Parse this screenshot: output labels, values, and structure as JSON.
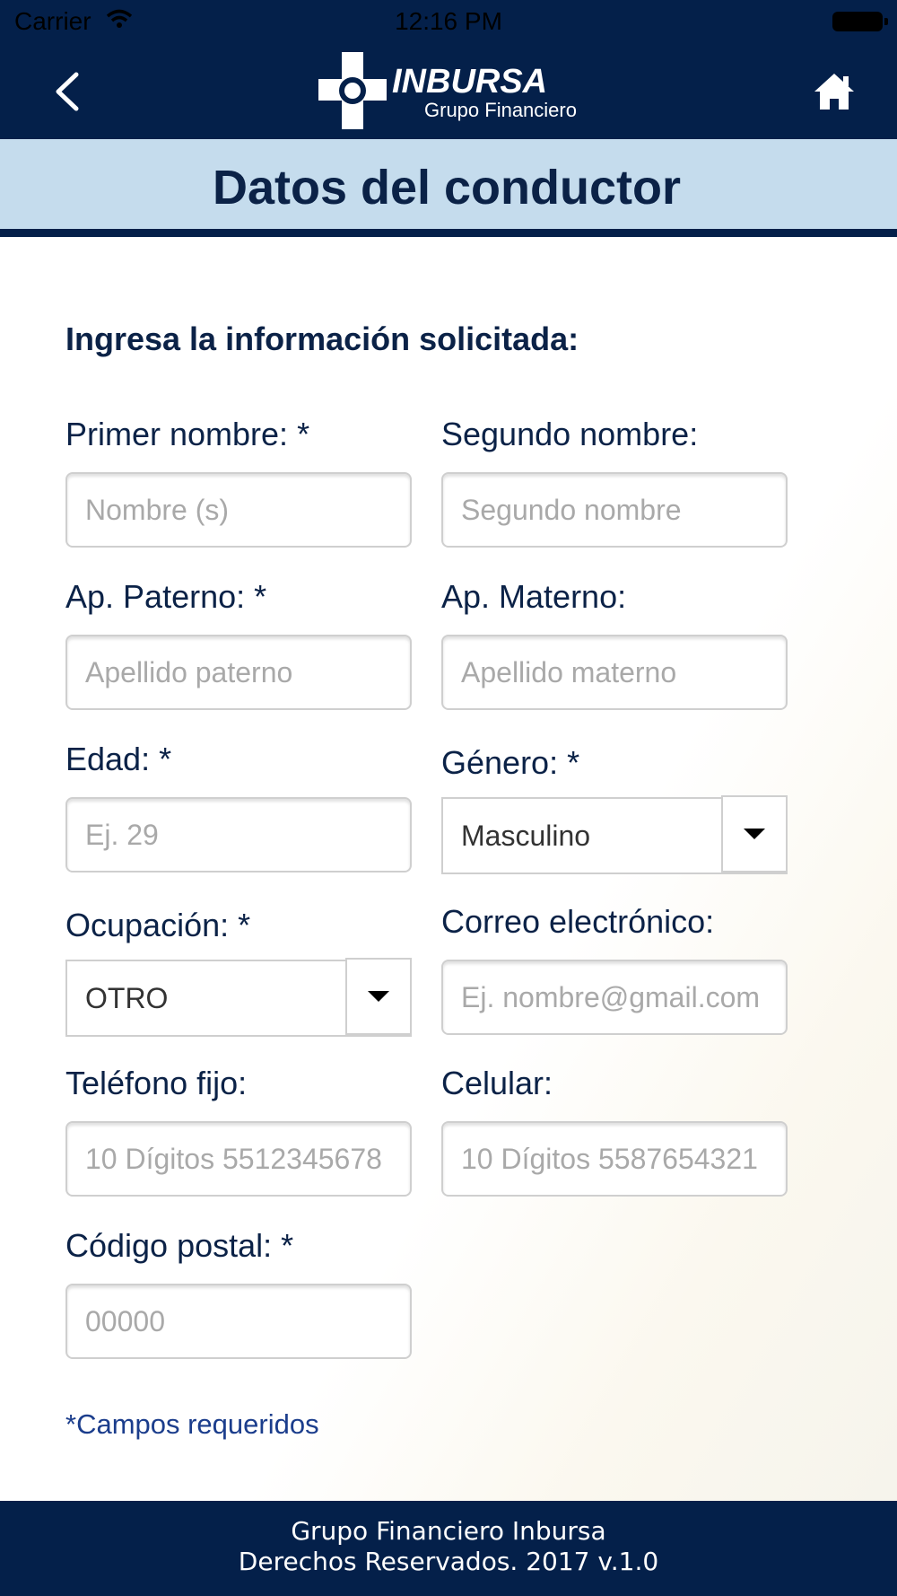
{
  "status_bar": {
    "carrier": "Carrier",
    "time": "12:16 PM"
  },
  "header": {
    "logo_name": "INBURSA",
    "logo_subtitle": "Grupo Financiero",
    "back_icon": "chevron-left-icon",
    "home_icon": "home-icon"
  },
  "page_title": "Datos del conductor",
  "intro": "Ingresa la información solicitada:",
  "form": {
    "first_name": {
      "label": "Primer nombre: *",
      "placeholder": "Nombre (s)"
    },
    "second_name": {
      "label": "Segundo nombre:",
      "placeholder": "Segundo nombre"
    },
    "paternal": {
      "label": "Ap. Paterno: *",
      "placeholder": "Apellido paterno"
    },
    "maternal": {
      "label": "Ap. Materno:",
      "placeholder": "Apellido materno"
    },
    "age": {
      "label": "Edad: *",
      "placeholder": "Ej. 29"
    },
    "gender": {
      "label": "Género: *",
      "value": "Masculino"
    },
    "occupation": {
      "label": "Ocupación: *",
      "value": "OTRO"
    },
    "email": {
      "label": "Correo electrónico:",
      "placeholder": "Ej. nombre@gmail.com"
    },
    "landline": {
      "label": "Teléfono fijo:",
      "placeholder": "10 Dígitos 5512345678"
    },
    "mobile": {
      "label": "Celular:",
      "placeholder": "10 Dígitos 5587654321"
    },
    "zip": {
      "label": "Código postal: *",
      "placeholder": "00000"
    }
  },
  "required_note": "*Campos requeridos",
  "footer": {
    "line1": "Grupo Financiero Inbursa",
    "line2": "Derechos Reservados.  2017 v.1.0"
  },
  "colors": {
    "navy": "#04204a",
    "title_band": "#c5dced",
    "text_dark": "#0b2247",
    "link": "#1b3d8c"
  }
}
